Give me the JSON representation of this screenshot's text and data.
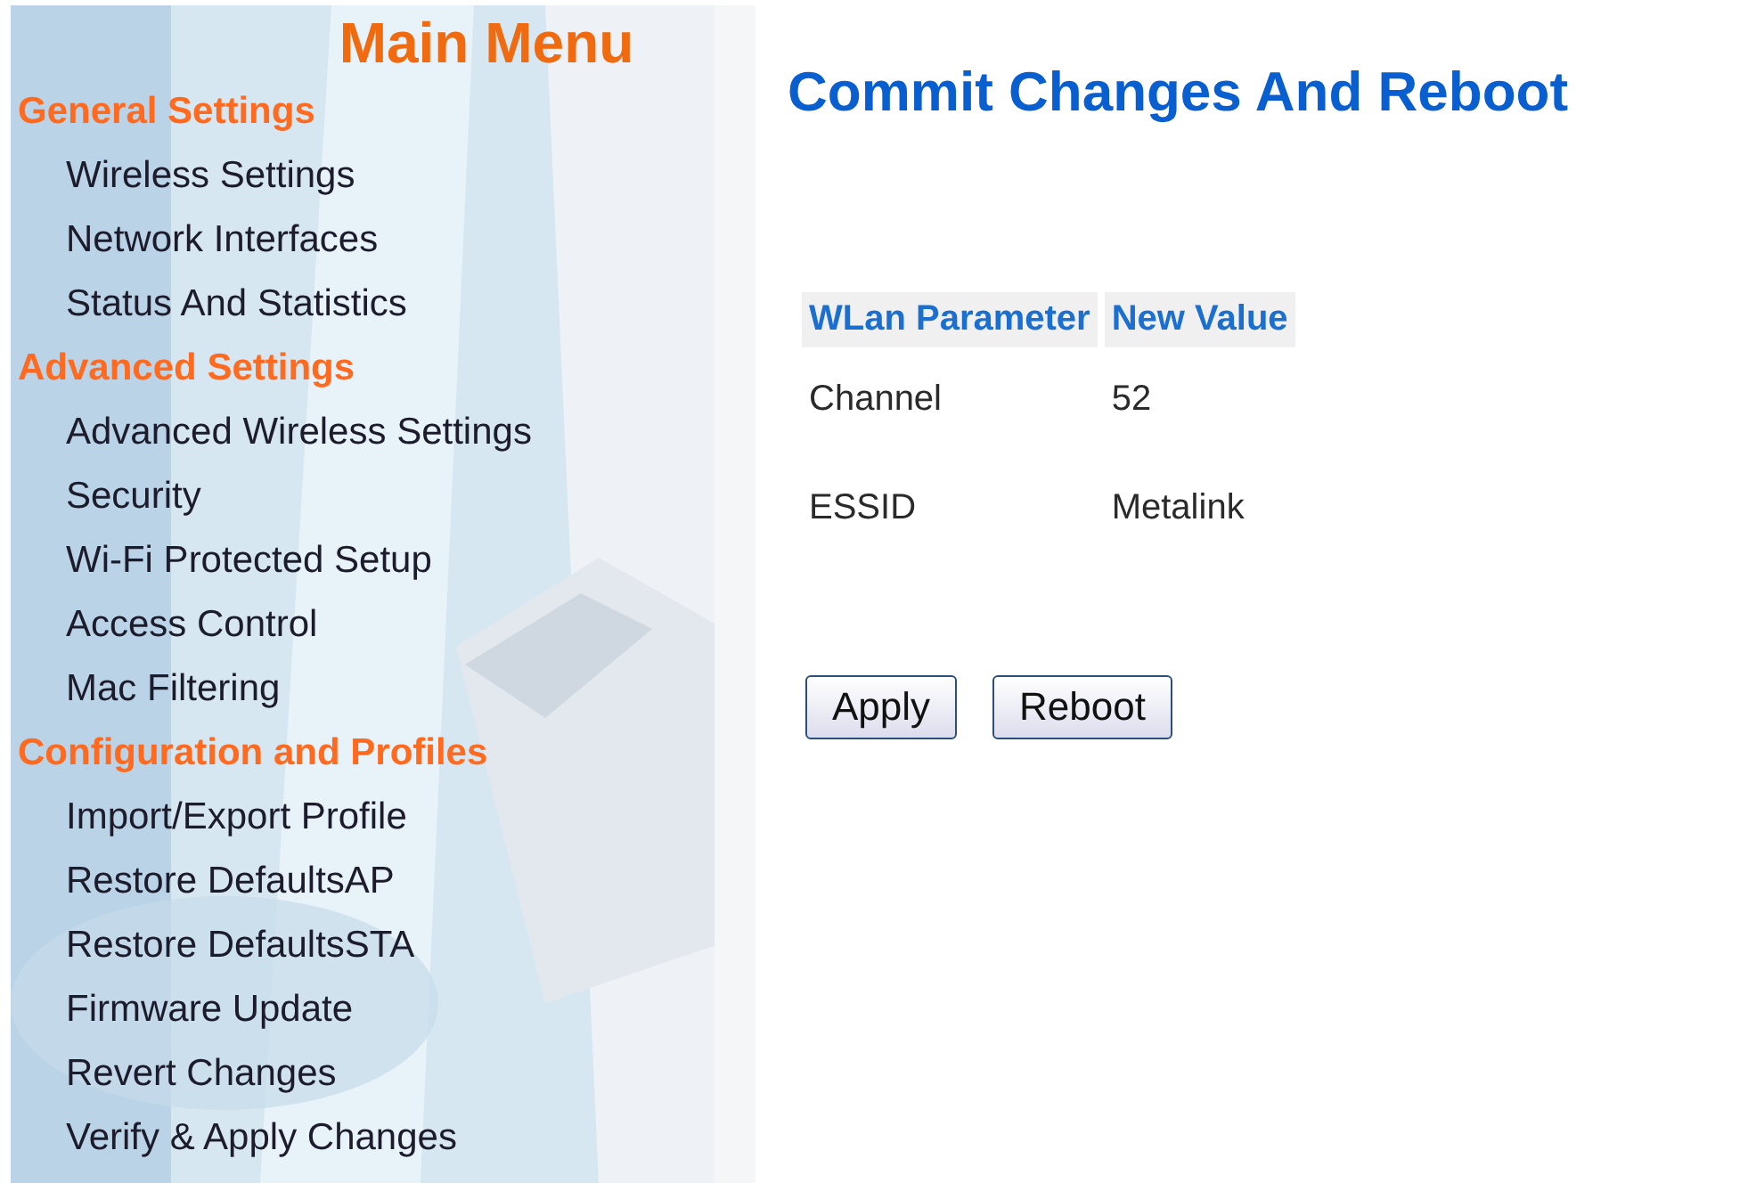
{
  "sidebar": {
    "title": "Main Menu",
    "sections": [
      {
        "heading": "General Settings",
        "items": [
          "Wireless Settings",
          "Network Interfaces",
          "Status And Statistics"
        ]
      },
      {
        "heading": "Advanced Settings",
        "items": [
          "Advanced Wireless Settings",
          "Security",
          "Wi-Fi Protected Setup",
          "Access Control",
          "Mac Filtering"
        ]
      },
      {
        "heading": "Configuration and Profiles",
        "items": [
          "Import/Export Profile",
          "Restore DefaultsAP",
          "Restore DefaultsSTA",
          "Firmware Update",
          "Revert Changes",
          "Verify & Apply Changes"
        ]
      }
    ]
  },
  "page": {
    "title": "Commit Changes And Reboot",
    "table": {
      "columns": [
        "WLan Parameter",
        "New Value"
      ],
      "rows": [
        [
          "Channel",
          "52"
        ],
        [
          "ESSID",
          "Metalink"
        ]
      ]
    },
    "buttons": [
      "Apply",
      "Reboot"
    ]
  }
}
